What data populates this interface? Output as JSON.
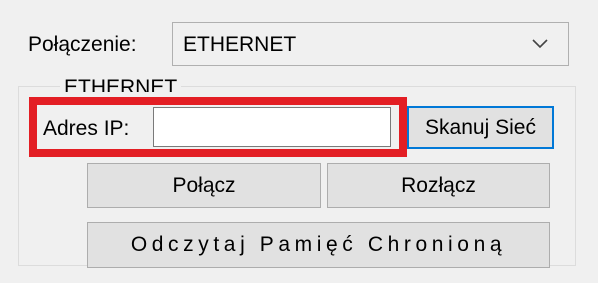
{
  "connection": {
    "label": "Połączenie:",
    "selected": "ETHERNET"
  },
  "group": {
    "title": "ETHERNET",
    "ip_label": "Adres IP:",
    "ip_value": "",
    "scan_button": "Skanuj Sieć",
    "connect_button": "Połącz",
    "disconnect_button": "Rozłącz",
    "read_memory_button": "Odczytaj Pamięć Chronioną"
  },
  "colors": {
    "window_bg": "#f0f0f0",
    "highlight": "#e31e24",
    "focus_border": "#0078d7",
    "button_bg": "#e1e1e1"
  },
  "icons": {
    "dropdown": "chevron-down-icon"
  }
}
